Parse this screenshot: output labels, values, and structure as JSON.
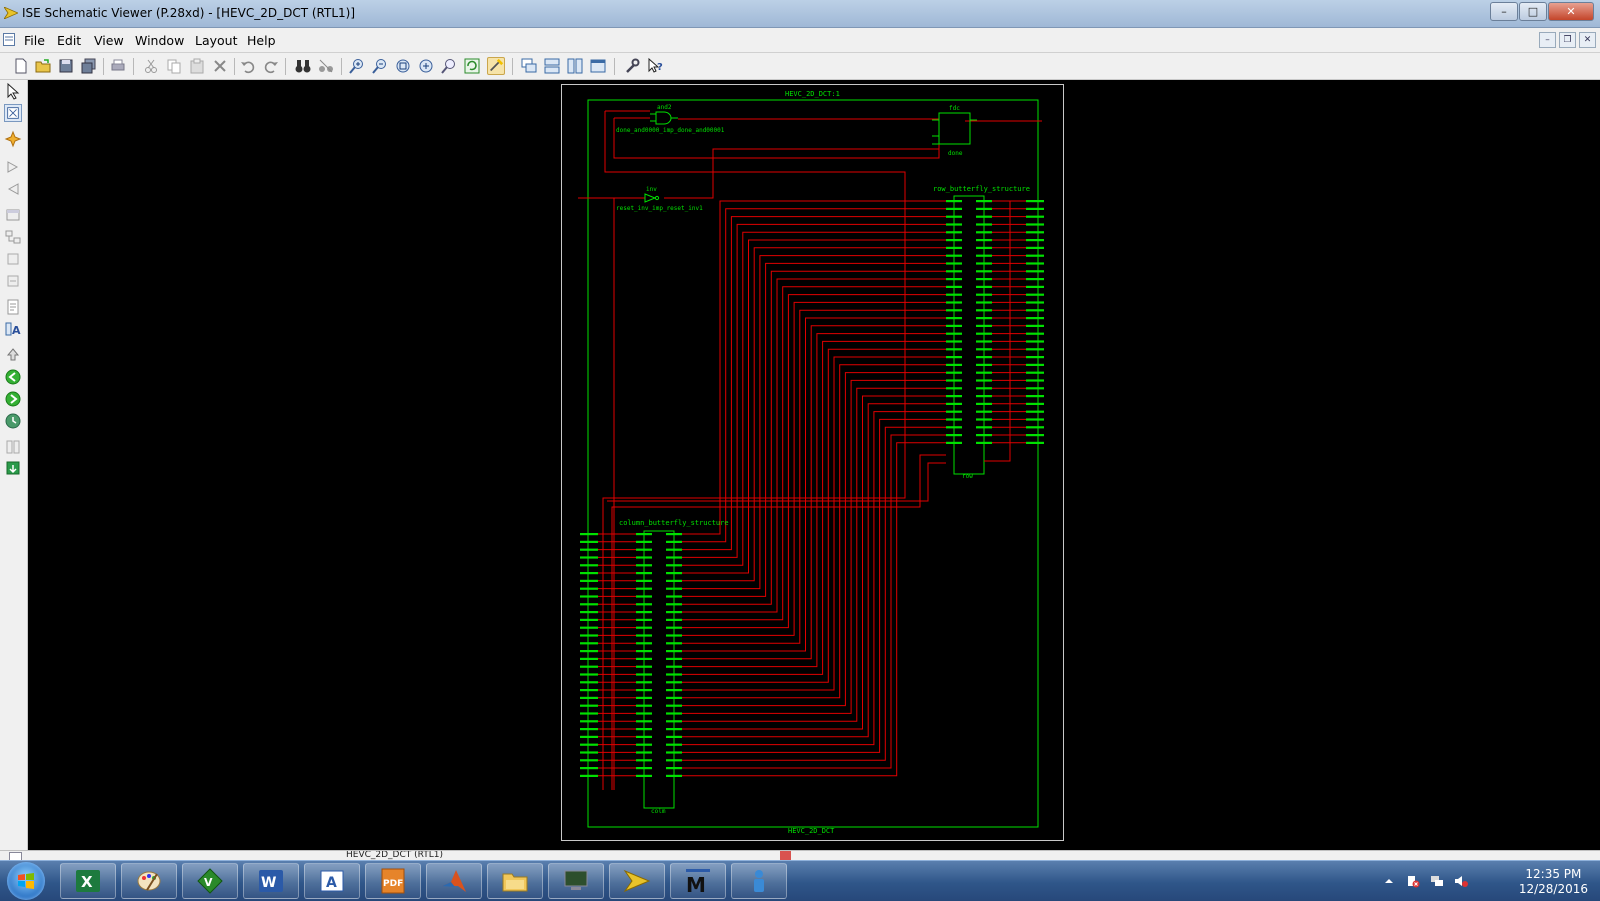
{
  "window": {
    "title": "ISE Schematic Viewer (P.28xd) - [HEVC_2D_DCT (RTL1)]"
  },
  "menubar": {
    "items": [
      "File",
      "Edit",
      "View",
      "Window",
      "Layout",
      "Help"
    ]
  },
  "schematic": {
    "sheet_title_top": "HEVC_2D_DCT:1",
    "sheet_title_bottom": "HEVC_2D_DCT",
    "and_gate_type": "and2",
    "and_gate_name": "done_and0000_imp_done_and00001",
    "inv_type": "inv",
    "inv_name": "reset_inv_imp_reset_inv1",
    "fdc_type": "fdc",
    "fdc_name": "done",
    "row_block_title": "row_butterfly_structure",
    "row_block_name": "row",
    "col_block_title": "column_butterfly_structure",
    "col_block_name": "colm"
  },
  "status": {
    "document_tab": "HEVC_2D_DCT (RTL1)"
  },
  "taskbar": {
    "apps": [
      "Excel",
      "Paint",
      "Vim",
      "Word",
      "Access",
      "PDF",
      "MATLAB",
      "Explorer",
      "Device",
      "Xilinx ISE",
      "ModelSim",
      "Info"
    ],
    "time": "12:35 PM",
    "date": "12/28/2016"
  }
}
